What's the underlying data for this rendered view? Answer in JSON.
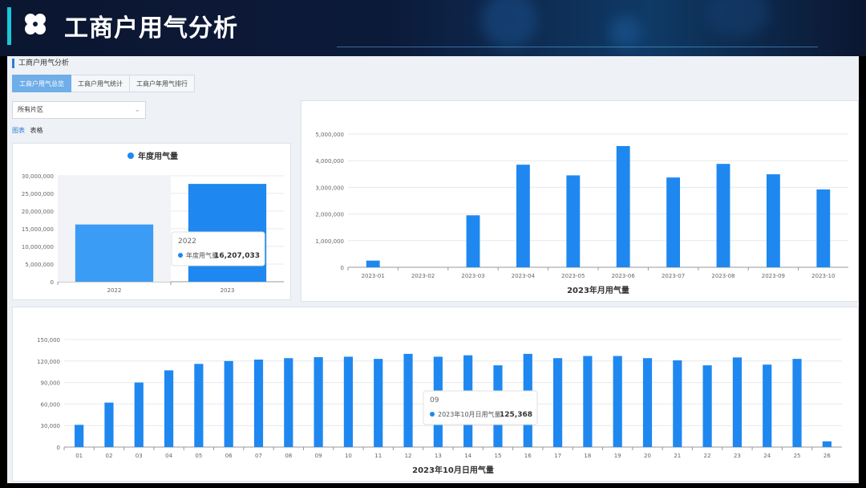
{
  "header": {
    "title": "工商户用气分析"
  },
  "breadcrumb": "工商户用气分析",
  "tabs": [
    {
      "label": "工商户用气总览",
      "active": true
    },
    {
      "label": "工商户用气统计",
      "active": false
    },
    {
      "label": "工商户年用气排行",
      "active": false
    }
  ],
  "filter": {
    "region": "所有片区"
  },
  "view_toggle": {
    "chart_label": "图表",
    "table_label": "表格"
  },
  "colors": {
    "bar": "#1e88f0",
    "bar_light": "#3a9cf5",
    "accent": "#19c8d8"
  },
  "chart_data": [
    {
      "id": "annual",
      "type": "bar",
      "legend": "年度用气量",
      "categories": [
        "2022",
        "2023"
      ],
      "values": [
        16207033,
        27700000
      ],
      "ylim": [
        0,
        30000000
      ],
      "yticks": [
        "0",
        "5,000,000",
        "10,000,000",
        "15,000,000",
        "20,000,000",
        "25,000,000",
        "30,000,000"
      ],
      "tooltip": {
        "title": "2022",
        "series": "年度用气量",
        "value": "16,207,033"
      }
    },
    {
      "id": "monthly",
      "type": "bar",
      "title": "2023年月用气量",
      "categories": [
        "2023-01",
        "2023-02",
        "2023-03",
        "2023-04",
        "2023-05",
        "2023-06",
        "2023-07",
        "2023-08",
        "2023-09",
        "2023-10"
      ],
      "values": [
        250000,
        0,
        1950000,
        3850000,
        3450000,
        4550000,
        3370000,
        3880000,
        3490000,
        2920000
      ],
      "ylim": [
        0,
        5000000
      ],
      "yticks": [
        "0",
        "1,000,000",
        "2,000,000",
        "3,000,000",
        "4,000,000",
        "5,000,000"
      ]
    },
    {
      "id": "daily",
      "type": "bar",
      "title": "2023年10月日用气量",
      "categories": [
        "01",
        "02",
        "03",
        "04",
        "05",
        "06",
        "07",
        "08",
        "09",
        "10",
        "11",
        "12",
        "13",
        "14",
        "15",
        "16",
        "17",
        "18",
        "19",
        "20",
        "21",
        "22",
        "23",
        "24",
        "25",
        "26"
      ],
      "values": [
        31000,
        62000,
        90000,
        107000,
        116000,
        120000,
        122000,
        124000,
        125368,
        126000,
        123000,
        130000,
        126000,
        128000,
        114000,
        130000,
        124000,
        127000,
        127000,
        124000,
        121000,
        114000,
        125000,
        115000,
        123000,
        8000
      ],
      "ylim": [
        0,
        150000
      ],
      "yticks": [
        "0",
        "30,000",
        "60,000",
        "90,000",
        "120,000",
        "150,000"
      ],
      "tooltip": {
        "title": "09",
        "series": "2023年10月日用气量",
        "value": "125,368"
      }
    }
  ]
}
